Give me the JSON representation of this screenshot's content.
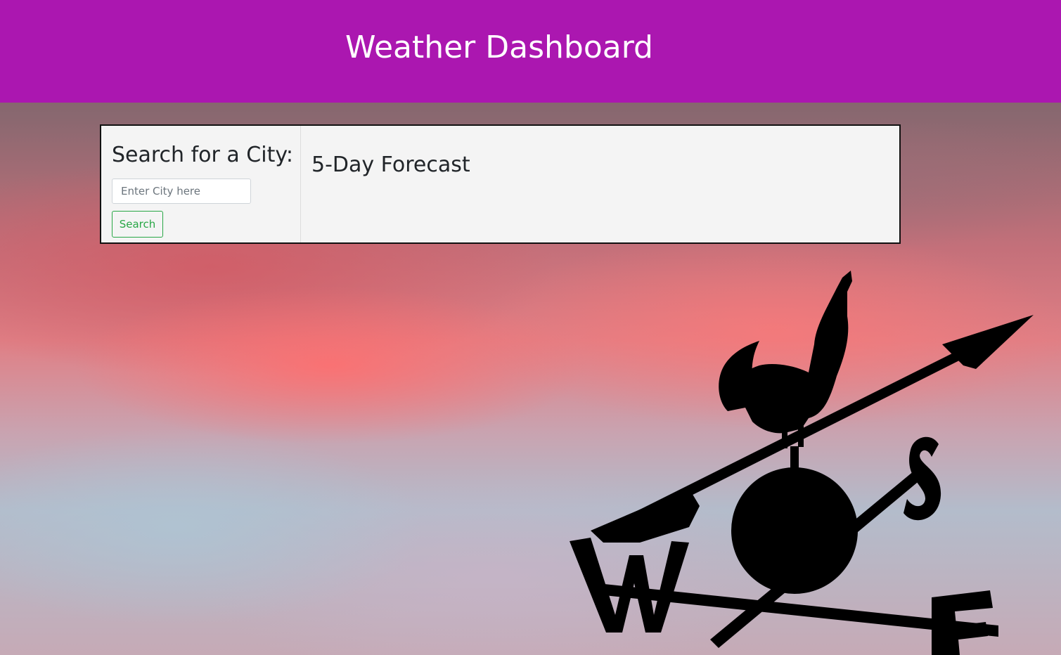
{
  "header": {
    "title": "Weather Dashboard"
  },
  "search": {
    "title": "Search for a City:",
    "input_placeholder": "Enter City here",
    "input_value": "",
    "button_label": "Search"
  },
  "forecast": {
    "title": "5-Day Forecast"
  },
  "colors": {
    "header_bg": "#ab17b0",
    "panel_bg": "#f4f4f4",
    "button_accent": "#28a745"
  }
}
